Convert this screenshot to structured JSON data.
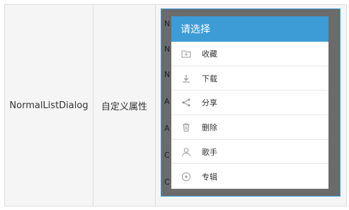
{
  "table": {
    "name_cell": "NormalListDialog",
    "desc_cell": "自定义属性"
  },
  "background_letters": [
    "N",
    "N",
    "N",
    "A",
    "A",
    "C",
    "C"
  ],
  "dialog": {
    "title": "请选择",
    "header_color": "#3d9bd6",
    "items": [
      {
        "label": "收藏",
        "icon": "folder-plus-icon"
      },
      {
        "label": "下载",
        "icon": "download-icon"
      },
      {
        "label": "分享",
        "icon": "share-icon"
      },
      {
        "label": "删除",
        "icon": "trash-icon"
      },
      {
        "label": "歌手",
        "icon": "person-icon"
      },
      {
        "label": "专辑",
        "icon": "disc-icon"
      }
    ]
  }
}
